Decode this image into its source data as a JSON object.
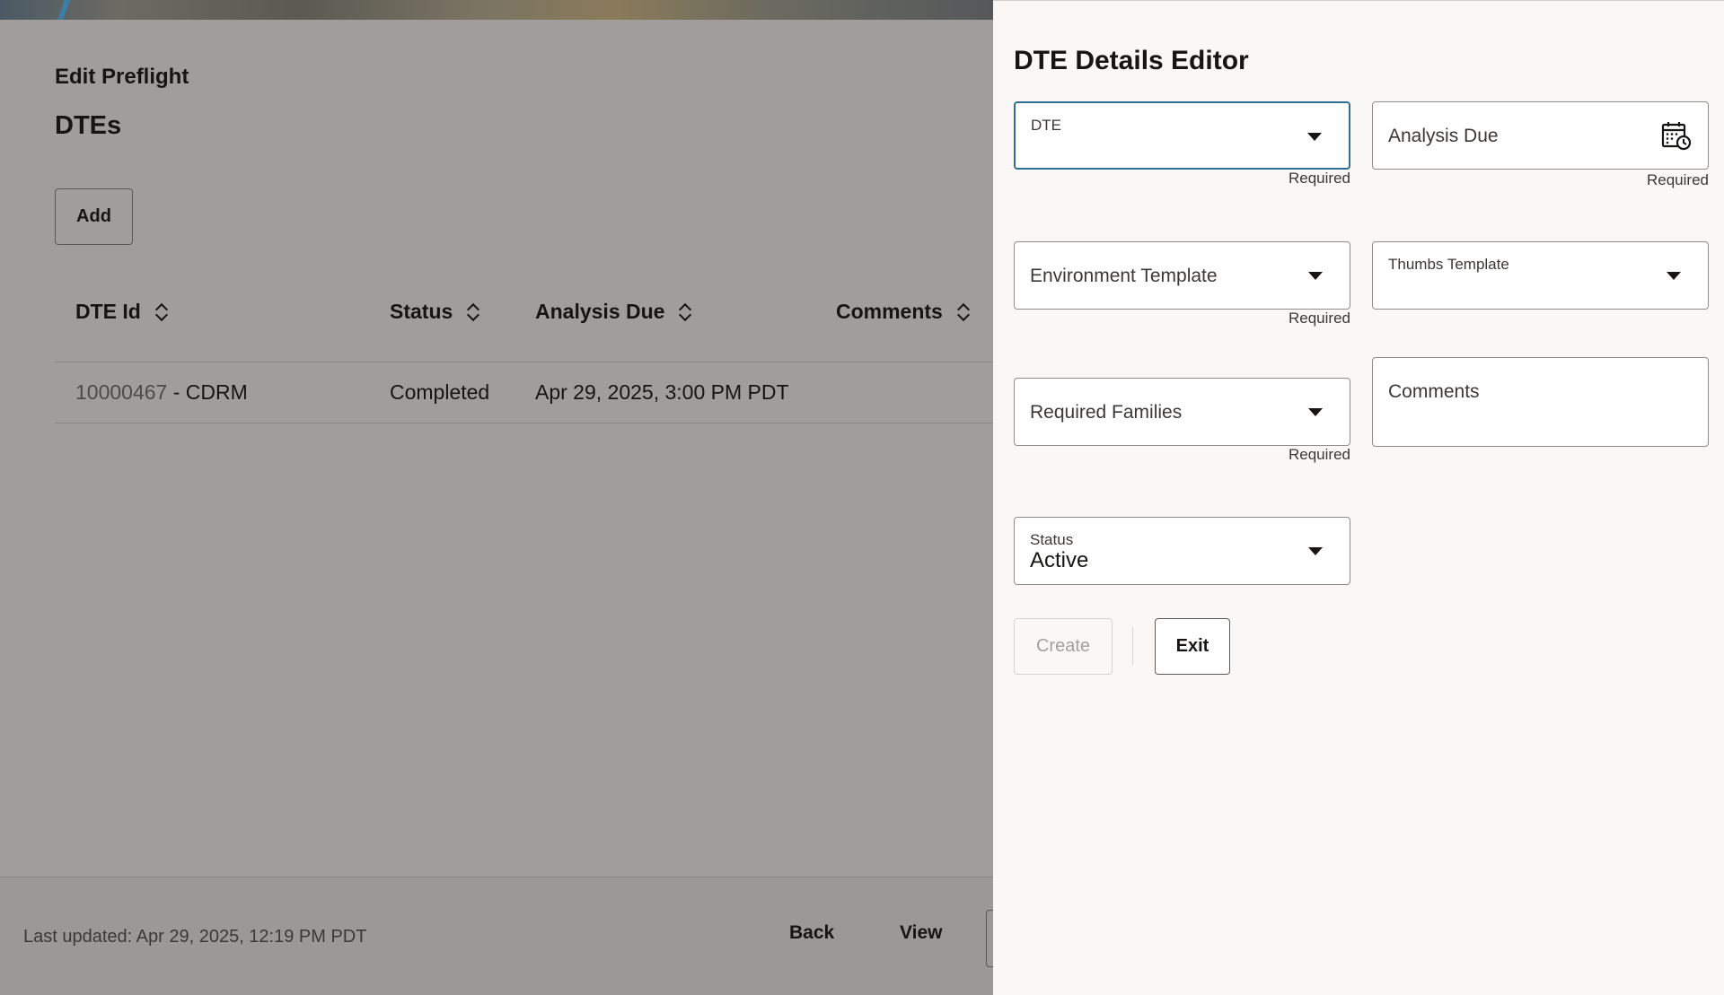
{
  "page": {
    "heading": "Edit Preflight",
    "section_title": "DTEs",
    "add_label": "Add"
  },
  "table": {
    "columns": [
      "DTE Id",
      "Status",
      "Analysis Due",
      "Comments"
    ],
    "rows": [
      {
        "dte_id": "10000467",
        "dte_suffix": " - CDRM",
        "status": "Completed",
        "analysis_due": "Apr 29, 2025, 3:00 PM PDT",
        "comments": ""
      }
    ]
  },
  "footer": {
    "last_updated": "Last updated: Apr 29, 2025, 12:19 PM PDT",
    "back_label": "Back",
    "view_label": "View"
  },
  "drawer": {
    "title": "DTE Details Editor",
    "required_text": "Required",
    "fields": {
      "dte": {
        "label": "DTE",
        "value": ""
      },
      "analysis_due": {
        "label": "Analysis Due",
        "icon": "calendar-clock-icon"
      },
      "environment_template": {
        "label": "Environment Template"
      },
      "thumbs_template": {
        "label": "Thumbs Template",
        "value": ""
      },
      "required_families": {
        "label": "Required Families"
      },
      "comments": {
        "label": "Comments"
      },
      "status": {
        "label": "Status",
        "value": "Active"
      }
    },
    "create_label": "Create",
    "exit_label": "Exit"
  },
  "colors": {
    "overlay_bg": "#a19d9b",
    "drawer_bg": "#f9f8f6",
    "focus_border": "#2e6f95",
    "text": "#161513"
  }
}
